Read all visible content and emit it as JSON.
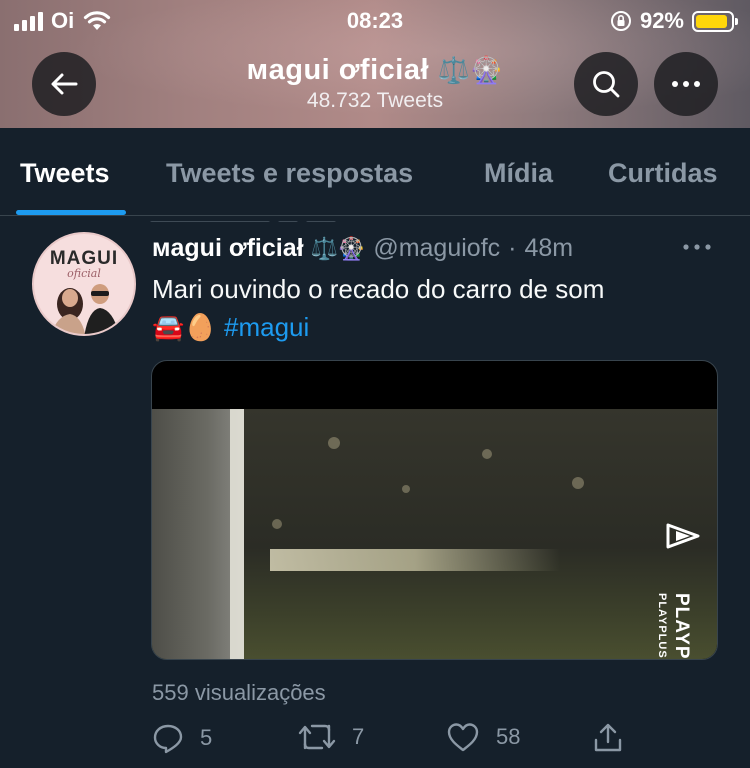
{
  "status_bar": {
    "carrier": "Oi",
    "time": "08:23",
    "battery_percent": "92%",
    "battery_level": 0.92,
    "battery_color": "#ffd60a"
  },
  "header": {
    "name": "ᴍagui ơficiał",
    "name_emoji": "⚖️🎡",
    "tweet_count": "48.732 Tweets"
  },
  "tabs": [
    {
      "label": "Tweets",
      "active": true
    },
    {
      "label": "Tweets e respostas",
      "active": false
    },
    {
      "label": "Mídia",
      "active": false
    },
    {
      "label": "Curtidas",
      "active": false
    }
  ],
  "tweet": {
    "avatar_title": "MAGUI",
    "avatar_sub": "oficial",
    "display_name": "ᴍagui ơficiał",
    "name_emoji": "⚖️🎡",
    "handle": "@maguiofc",
    "dot": "·",
    "time": "48m",
    "text": "Mari ouvindo o recado do carro de som",
    "emojis": "🚘🥚",
    "hashtag": "#magui",
    "media_watermark": "PLAYPLUS",
    "media_watermark_sub": "PLAYPLUS.COM",
    "views": "559 visualizações",
    "reply_count": "5",
    "retweet_count": "7",
    "like_count": "58"
  },
  "colors": {
    "background": "#15202b",
    "accent": "#1d9bf0",
    "muted": "#8b98a5",
    "divider": "#38444d"
  }
}
